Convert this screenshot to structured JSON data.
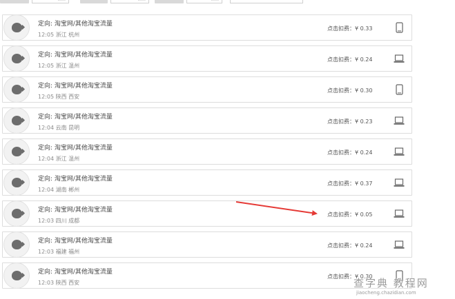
{
  "topbar": {
    "filters": [
      {
        "label": "",
        "value": ""
      },
      {
        "label": "",
        "value": ""
      },
      {
        "label": "",
        "value": ""
      }
    ],
    "search_value": "",
    "search_clear": "×"
  },
  "rows": [
    {
      "title": "定向: 淘宝网/其他淘宝流量",
      "meta": "12:05 浙江 杭州",
      "price": "点击扣费：¥ 0.33",
      "device": "tablet"
    },
    {
      "title": "定向: 淘宝网/其他淘宝流量",
      "meta": "12:05 浙江 温州",
      "price": "点击扣费：¥ 0.24",
      "device": "laptop"
    },
    {
      "title": "定向: 淘宝网/其他淘宝流量",
      "meta": "12:05 陕西 西安",
      "price": "点击扣费：¥ 0.30",
      "device": "tablet"
    },
    {
      "title": "定向: 淘宝网/其他淘宝流量",
      "meta": "12:04 云南 昆明",
      "price": "点击扣费：¥ 0.23",
      "device": "laptop"
    },
    {
      "title": "定向: 淘宝网/其他淘宝流量",
      "meta": "12:04 浙江 温州",
      "price": "点击扣费：¥ 0.24",
      "device": "laptop"
    },
    {
      "title": "定向: 淘宝网/其他淘宝流量",
      "meta": "12:04 湖南 郴州",
      "price": "点击扣费：¥ 0.37",
      "device": "laptop"
    },
    {
      "title": "定向: 淘宝网/其他淘宝流量",
      "meta": "12:03 四川 成都",
      "price": "点击扣费：¥ 0.05",
      "device": "laptop"
    },
    {
      "title": "定向: 淘宝网/其他淘宝流量",
      "meta": "12:03 福建 福州",
      "price": "点击扣费：¥ 0.24",
      "device": "laptop"
    },
    {
      "title": "定向: 淘宝网/其他淘宝流量",
      "meta": "12:03 陕西 西安",
      "price": "点击扣费：¥ 0.30",
      "device": "tablet"
    }
  ],
  "annotation": {
    "color": "#e53935",
    "points_to_row": 6
  },
  "watermark": {
    "main": "查字典 教程网",
    "sub": "jiaocheng.chazidian.com"
  },
  "colors": {
    "border": "#dcdcdc",
    "text": "#4a4a4a",
    "muted": "#8a8a8a",
    "icon": "#666666"
  }
}
